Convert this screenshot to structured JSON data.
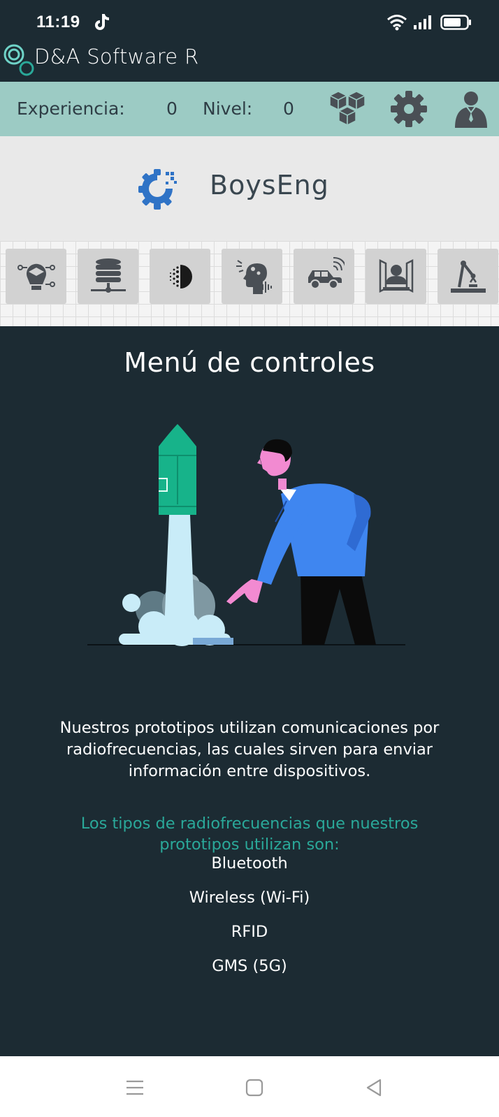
{
  "status_bar": {
    "time": "11:19"
  },
  "app_bar": {
    "title": "D&A Software R"
  },
  "stats": {
    "experience_label": "Experiencia:",
    "experience_value": "0",
    "level_label": "Nivel:",
    "level_value": "0"
  },
  "brand": {
    "name": "BoysEng"
  },
  "main": {
    "title": "Menú de controles",
    "intro": "Nuestros prototipos utilizan comunicaciones por radiofrecuencias, las cuales sirven para enviar información entre dispositivos.",
    "rf_heading": "Los tipos de radiofrecuencias que nuestros prototipos utilizan son:",
    "rf_types": [
      "Bluetooth",
      "Wireless (Wi-Fi)",
      "RFID",
      "GMS (5G)"
    ]
  },
  "colors": {
    "background_dark": "#1c2b33",
    "stats_bar": "#9ccbc4",
    "accent_teal": "#2aa899",
    "brand_blue": "#2f73c6"
  }
}
